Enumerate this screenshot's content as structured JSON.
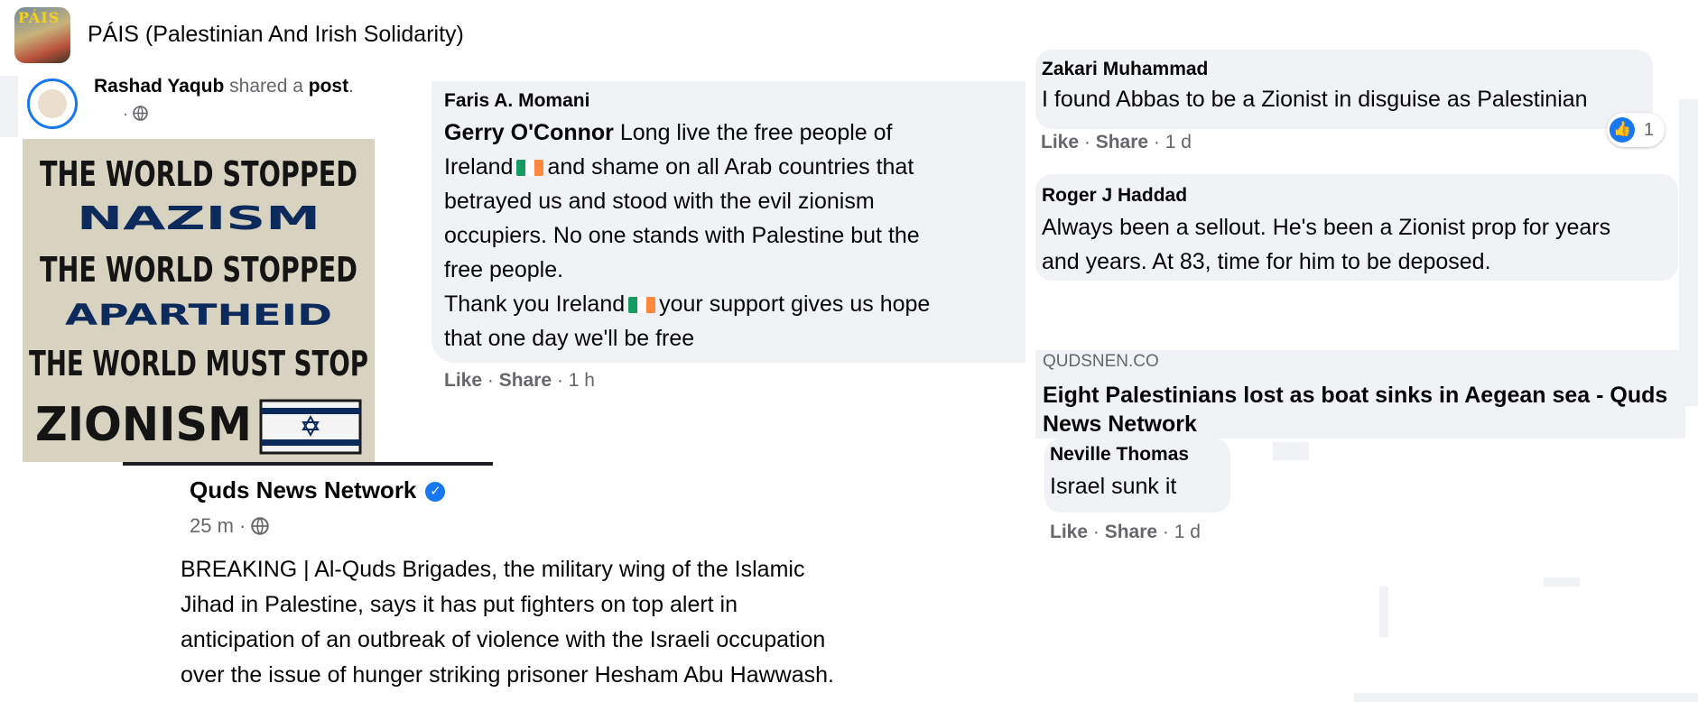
{
  "group": {
    "name": "PÁIS (Palestinian And Irish Solidarity)",
    "avatar_text": "PÁIS"
  },
  "share": {
    "sharer": "Rashad Yaqub",
    "shared_a": "shared a",
    "post": "post",
    "period": ".",
    "meta": "·"
  },
  "image": {
    "lines": [
      "THE WORLD STOPPED",
      "NAZISM",
      "THE WORLD STOPPED",
      "APARTHEID",
      "THE WORLD MUST STOP",
      "ZIONISM"
    ]
  },
  "comment1": {
    "author": "Faris A. Momani",
    "tagged": "Gerry O'Connor",
    "line1": " Long live the free people of",
    "line2a": "Ireland",
    "line2b": "and shame on all Arab countries that",
    "line3": "betrayed us and stood with the evil zionism",
    "line4": "occupiers. No one stands with Palestine but the",
    "line5": "free people.",
    "line6a": "Thank you Ireland",
    "line6b": "your support gives us hope",
    "line7": "that one day we'll be free",
    "like": "Like",
    "share": "Share",
    "time": "1 h"
  },
  "qnn": {
    "name": "Quds News Network",
    "time": "25 m",
    "lines": [
      " BREAKING | Al-Quds Brigades, the military wing of the Islamic",
      "Jihad in Palestine, says it has put fighters on top alert in",
      "anticipation of an outbreak of violence with the Israeli occupation",
      "over the issue of hunger striking prisoner Hesham Abu Hawwash."
    ]
  },
  "comment2": {
    "author": "Zakari Muhammad",
    "text": "I found Abbas to be a Zionist in disguise as Palestinian",
    "like": "Like",
    "share": "Share",
    "time": "1 d",
    "reaction_count": "1"
  },
  "comment3": {
    "author": "Roger J Haddad",
    "line1": "Always been a sellout. He's been a Zionist prop for years",
    "line2": "and years. At 83, time for him to be deposed."
  },
  "link": {
    "domain": "QUDSNEN.CO",
    "title_line1": "Eight Palestinians lost as boat sinks in Aegean sea - Quds",
    "title_line2": "News Network"
  },
  "comment4": {
    "author": "Neville Thomas",
    "text": "Israel sunk it",
    "like": "Like",
    "share": "Share",
    "time": "1 d"
  },
  "colors": {
    "bubble": "#f0f2f5",
    "accent": "#1877f2",
    "muted": "#65676b"
  },
  "icons": [
    "globe-icon",
    "verified-badge-icon",
    "like-reaction-icon",
    "ireland-flag-icon",
    "israel-flag-icon"
  ]
}
